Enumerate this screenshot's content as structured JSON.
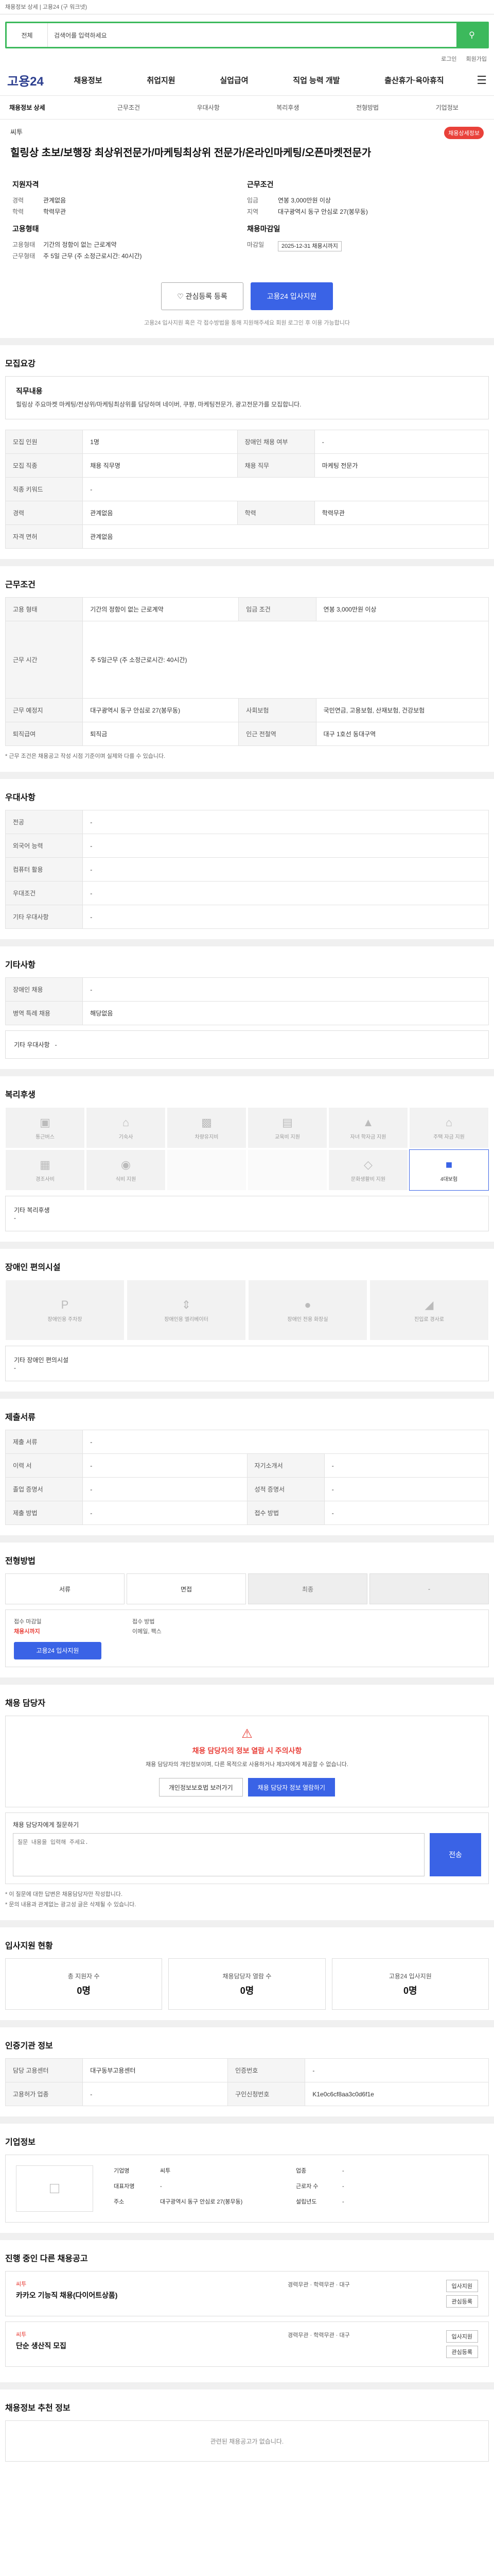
{
  "topnote": "채용정보 상세 | 고용24 (구 워크넷)",
  "search": {
    "scope": "전체",
    "placeholder": "검색어를 입력하세요"
  },
  "util": [
    "로그인",
    "회원가입"
  ],
  "gnb": {
    "logo": "고용24",
    "menu": [
      "채용정보",
      "취업지원",
      "실업급여",
      "직업 능력 개발",
      "출산휴가·육아휴직"
    ]
  },
  "tabs": [
    "채용정보 상세",
    "근무조건",
    "우대사항",
    "복리후생",
    "전형방법",
    "기업정보"
  ],
  "header": {
    "company": "씨투",
    "badge": "채용상세정보",
    "title": "힐링상 초보/보행장 최상위전문가/마케팅최상위 전문가/온라인마케팅/오픈마켓전문가"
  },
  "summary": {
    "left_title": "지원자격",
    "left": [
      [
        "경력",
        "관계없음"
      ],
      [
        "학력",
        "학력무관"
      ]
    ],
    "left2_title": "고용형태",
    "left2": [
      [
        "고용형태",
        "기간의 정함이 없는 근로계약"
      ],
      [
        "근무형태",
        "주 5일 근무 (주 소정근로시간: 40시간)"
      ]
    ],
    "right_title": "근무조건",
    "right": [
      [
        "임금",
        "연봉 3,000만원 이상"
      ],
      [
        "지역",
        "대구광역시 동구 안심로 27(봉무동)"
      ]
    ],
    "right2_title": "채용마감일",
    "right2": [
      [
        "마감일",
        "2025-12-31 채용시까지"
      ]
    ]
  },
  "actions": {
    "like": "관심등록 등록",
    "apply": "고용24 입사지원"
  },
  "notice": "고용24 입사지원 혹은 각 접수방법을 통해 지원해주세요 회원 로그인 후 이용 가능합니다",
  "jobdesc": {
    "title": "모집요강",
    "box_title": "직무내용",
    "text": "힐링상 주요마켓 마케팅/전상위/마케팅최상위를 담당하며 네이버, 쿠팡, 마케팅전문가, 광고전문가를 모집합니다."
  },
  "reqtable": [
    [
      "모집 인원",
      "1명",
      "장애인 채용 여부",
      "-"
    ],
    [
      "모집 직종",
      "채용 직무명",
      "채용 직무",
      "마케팅 전문가"
    ],
    [
      "직종 키워드",
      "-",
      "",
      ""
    ],
    [
      "경력",
      "관계없음",
      "학력",
      "학력무관"
    ],
    [
      "자격 면허",
      "관계없음",
      "",
      ""
    ]
  ],
  "cond": {
    "title": "근무조건",
    "rows": [
      [
        "고용 형태",
        "기간의 정함이 없는 근로계약",
        "임금 조건",
        "연봉 3,000만원 이상"
      ],
      [
        "근무 시간",
        "주 5일근무 (주 소정근로시간: 40시간)",
        "",
        ""
      ],
      [
        "근무 예정지",
        "대구광역시 동구 안심로 27(봉무동)",
        "사회보험",
        "국민연금, 고용보험, 산재보험, 건강보험"
      ],
      [
        "퇴직급여",
        "퇴직금",
        "인근 전철역",
        "대구 1호선 동대구역"
      ]
    ],
    "footnote": "* 근무 조건은 채용공고 작성 시점 기준이며 실제와 다를 수 있습니다."
  },
  "pref": {
    "title": "우대사항",
    "rows": [
      [
        "전공",
        "-"
      ],
      [
        "외국어 능력",
        "-"
      ],
      [
        "컴퓨터 활용",
        "-"
      ],
      [
        "우대조건",
        "-"
      ],
      [
        "기타 우대사항",
        "-"
      ]
    ]
  },
  "other": {
    "title": "기타사항",
    "rows": [
      [
        "장애인 채용",
        "-"
      ],
      [
        "병역 특례 채용",
        "해당없음"
      ],
      [
        "기타 우대사항",
        "-"
      ]
    ]
  },
  "welfare": {
    "title": "복리후생",
    "items": [
      "통근버스",
      "기숙사",
      "차량유지비",
      "교육비 지원",
      "자녀 학자금 지원",
      "주택 자금 지원",
      "경조사비",
      "식비 지원",
      "",
      "",
      "문화생활비 지원",
      "4대보험"
    ],
    "on_index": 11,
    "extra_label": "기타 복리후생",
    "extra_value": "-"
  },
  "disab": {
    "title": "장애인 편의시설",
    "items": [
      "장애인용 주차장",
      "장애인용 엘리베이터",
      "장애인 전용 화장실",
      "진입로 경사로"
    ],
    "extra_label": "기타 장애인 편의시설",
    "extra_value": "-"
  },
  "docs": {
    "title": "제출서류",
    "rows": [
      [
        "제출 서류",
        "-",
        "",
        ""
      ],
      [
        "이력 서",
        "-",
        "자기소개서",
        "-"
      ],
      [
        "졸업 증명서",
        "-",
        "성적 증명서",
        "-"
      ],
      [
        "제출 방법",
        "-",
        "접수 방법",
        "-"
      ]
    ]
  },
  "process": {
    "title": "전형방법",
    "steps": [
      "서류",
      "면접",
      "최종",
      "-"
    ],
    "deadline_label": "접수 마감일",
    "deadline": "채용시까지",
    "method_label": "접수 방법",
    "method": "이메일, 팩스",
    "apply_btn": "고용24 입사지원"
  },
  "contact": {
    "title": "채용 담당자",
    "callout_title": "채용 담당자의 정보 열람 시 주의사항",
    "callout_text": "채용 담당자의 개인정보이며, 다른 목적으로 사용하거나 제3자에게 제공할 수 없습니다.",
    "b1": "개인정보보호법 보러가기",
    "b2": "채용 담당자 정보 열람하기"
  },
  "question": {
    "title": "채용 담당자에게 질문하기",
    "placeholder": "질문 내용을 입력해 주세요.",
    "send": "전송",
    "notes": [
      "* 이 질문에 대한 답변은 채용담당자만 작성합니다.",
      "* 문의 내용과 관계없는 광고성 글은 삭제될 수 있습니다."
    ]
  },
  "stats": {
    "title": "입사지원 현황",
    "items": [
      [
        "총 지원자 수",
        "0명"
      ],
      [
        "채용담당자 열람 수",
        "0명"
      ],
      [
        "고용24 입사지원",
        "0명"
      ]
    ]
  },
  "registry": {
    "title": "인증기관 정보",
    "rows": [
      [
        "담당 고용센터",
        "대구동부고용센터",
        "인증번호",
        "-"
      ],
      [
        "고용허가 업종",
        "-",
        "구인신청번호",
        "K1e0c6cf8aa3c0d6f1e"
      ]
    ]
  },
  "company": {
    "title": "기업정보",
    "name": "씨투",
    "rows": [
      [
        "기업명",
        "씨투",
        "업종",
        "-"
      ],
      [
        "대표자명",
        "-",
        "근로자 수",
        "-"
      ],
      [
        "주소",
        "대구광역시 동구 안심로 27(봉무동)",
        "설립년도",
        "-"
      ]
    ]
  },
  "others": {
    "title": "진행 중인 다른 채용공고",
    "jobs": [
      {
        "co": "씨투",
        "title": "카카오 기능직 채용(다이어트상품)",
        "meta": "경력무관 · 학력무관 · 대구",
        "b1": "입사지원",
        "b2": "관심등록"
      },
      {
        "co": "씨투",
        "title": "단순 생산직 모집",
        "meta": "경력무관 · 학력무관 · 대구",
        "b1": "입사지원",
        "b2": "관심등록"
      }
    ]
  },
  "recommend": {
    "title": "채용정보 추천 정보",
    "empty": "관련된 채용공고가 없습니다."
  }
}
